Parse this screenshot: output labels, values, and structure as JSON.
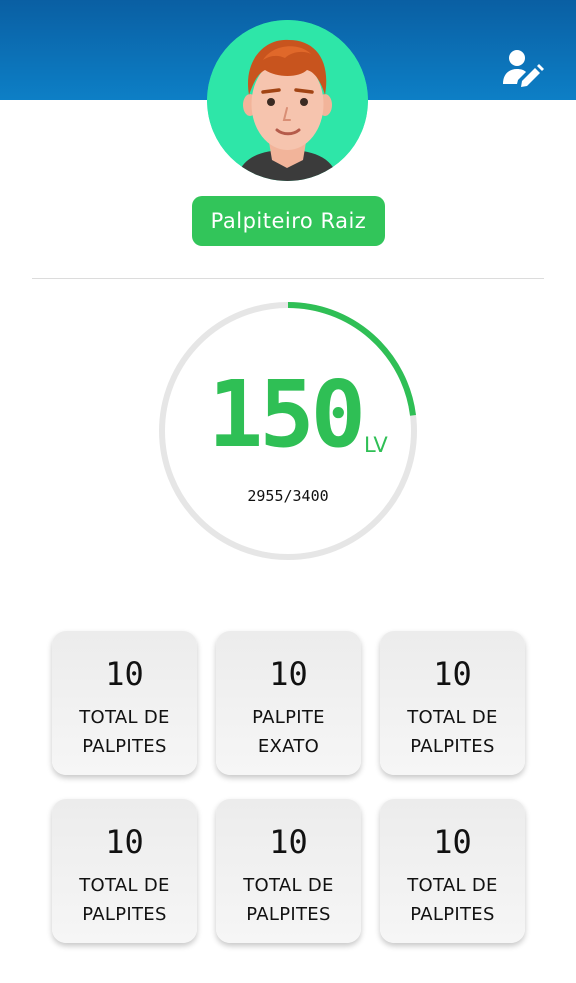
{
  "header": {
    "edit_icon": "user-edit-icon",
    "gradient_top": "#0a5fa3",
    "gradient_bottom": "#0d7fc6"
  },
  "profile": {
    "avatar_icon": "avatar-icon",
    "title": "Palpiteiro Raiz",
    "badge_color": "#32c55a"
  },
  "level": {
    "value": "150",
    "unit": "LV",
    "xp_text": "2955/3400",
    "progress_percent": 23,
    "accent": "#2fbf55"
  },
  "stats": [
    {
      "value": "10",
      "label_line1": "TOTAL DE",
      "label_line2": "PALPITES"
    },
    {
      "value": "10",
      "label_line1": "PALPITE",
      "label_line2": "EXATO"
    },
    {
      "value": "10",
      "label_line1": "TOTAL DE",
      "label_line2": "PALPITES"
    },
    {
      "value": "10",
      "label_line1": "TOTAL DE",
      "label_line2": "PALPITES"
    },
    {
      "value": "10",
      "label_line1": "TOTAL DE",
      "label_line2": "PALPITES"
    },
    {
      "value": "10",
      "label_line1": "TOTAL DE",
      "label_line2": "PALPITES"
    }
  ]
}
